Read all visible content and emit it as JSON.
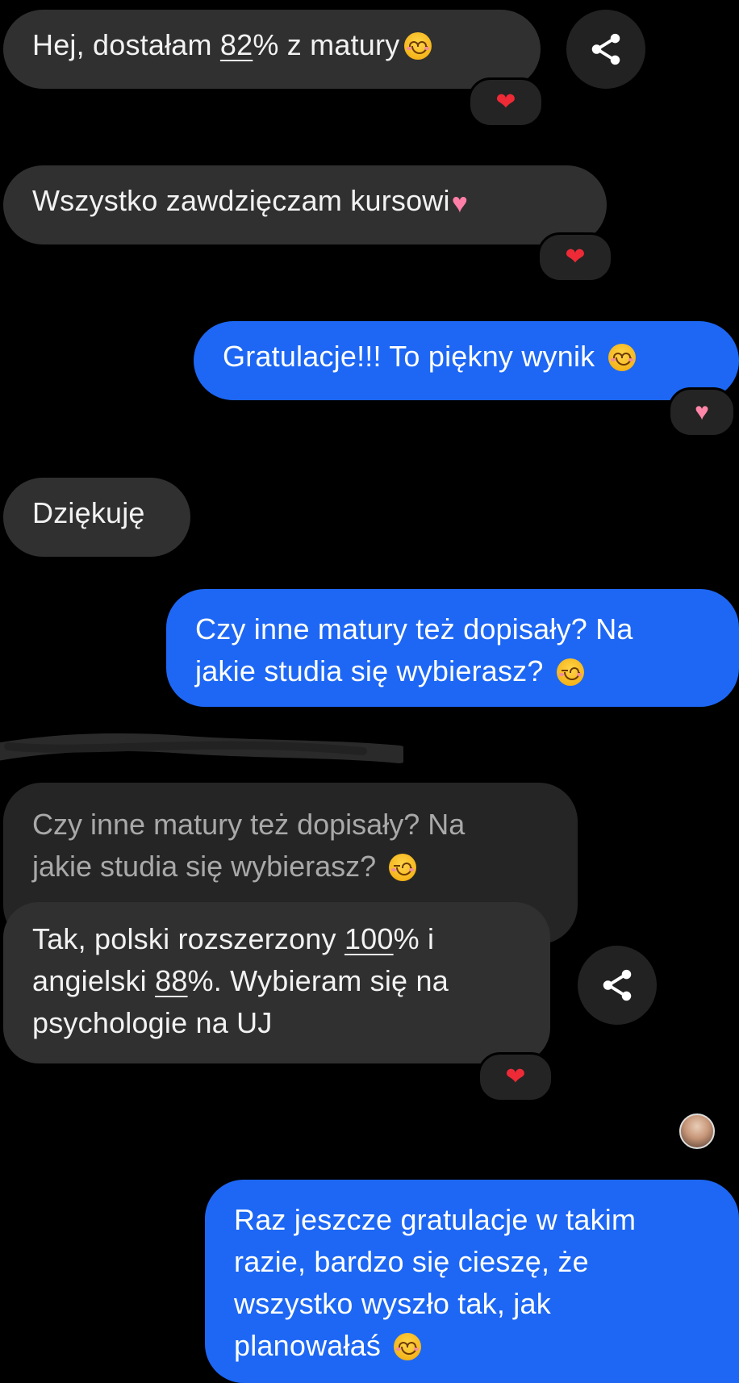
{
  "messages": [
    {
      "id": "m1",
      "side": "incoming",
      "parts": [
        "Hej, dostałam ",
        "82",
        "% z matury"
      ],
      "emoji": "smiling-face",
      "reaction": "red-heart"
    },
    {
      "id": "m2",
      "side": "incoming",
      "text": "Wszystko zawdzięczam kursowi",
      "emoji": "growing-heart",
      "reaction": "red-heart"
    },
    {
      "id": "m3",
      "side": "outgoing",
      "text": "Gratulacje!!! To piękny wynik ",
      "emoji": "smiling-face",
      "reaction": "growing-heart"
    },
    {
      "id": "m4",
      "side": "incoming",
      "text": "Dziękuję"
    },
    {
      "id": "m5",
      "side": "outgoing",
      "line1": "Czy inne matury też dopisały? Na",
      "line2": "jakie studia się wybierasz? ",
      "emoji": "winking-face"
    },
    {
      "id": "m6",
      "side": "incoming",
      "quote": {
        "line1": "Czy inne matury też dopisały? Na",
        "line2": "jakie studia się wybierasz? "
      },
      "line1_a": "Tak, polski rozszerzony ",
      "line1_u": "100",
      "line1_b": "% i",
      "line2_a": "angielski ",
      "line2_u": "88",
      "line2_b": "%. Wybieram się na",
      "line3": "psychologie na UJ",
      "reaction": "red-heart"
    },
    {
      "id": "m7",
      "side": "outgoing",
      "line1": "Raz jeszcze gratulacje w takim",
      "line2": "razie, bardzo się cieszę, że",
      "line3": "wszystko wyszło tak, jak",
      "line4": "planowałaś ",
      "emoji": "smiling-face"
    }
  ],
  "icons": {
    "share": "share-icon",
    "heart": "heart-icon",
    "avatar": "avatar"
  },
  "colors": {
    "background": "#000000",
    "incoming": "#303030",
    "outgoing": "#1d67f4",
    "reaction_heart": "#ee2a37"
  }
}
